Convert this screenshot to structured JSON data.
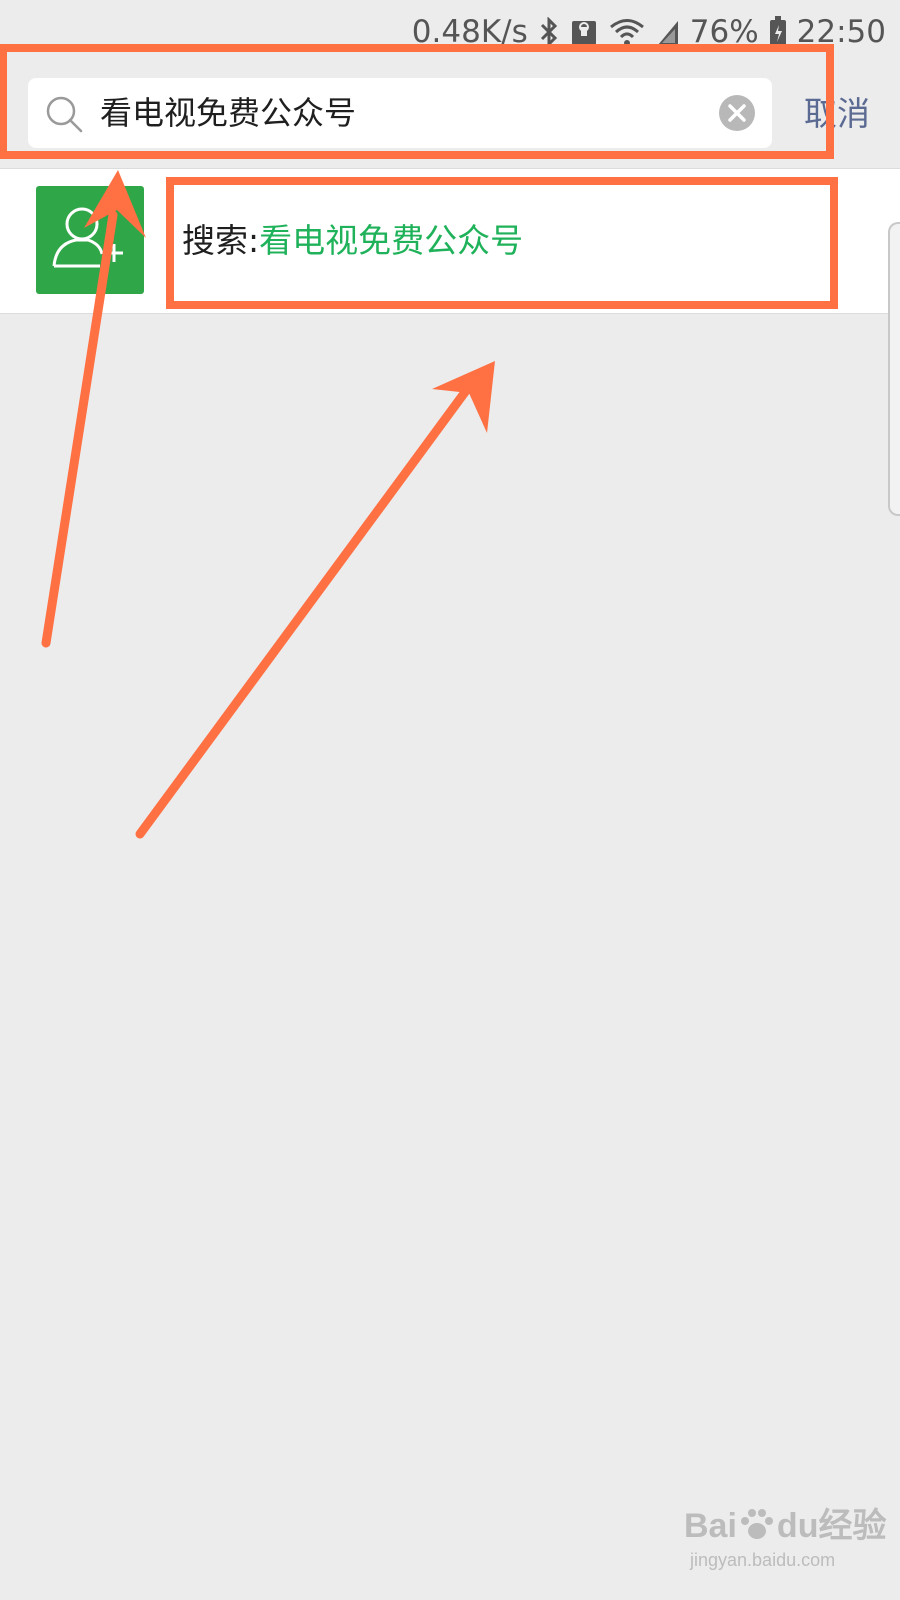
{
  "status_bar": {
    "speed": "0.48K/s",
    "battery": "76%",
    "time": "22:50",
    "icons": [
      "bluetooth-icon",
      "lock-icon",
      "wifi-icon",
      "signal-icon",
      "battery-icon"
    ]
  },
  "search": {
    "query": "看电视免费公众号",
    "cancel_label": "取消"
  },
  "result": {
    "prefix": "搜索:",
    "query": "看电视免费公众号",
    "icon": "add-contact-icon"
  },
  "watermark": {
    "brand_left": "Bai",
    "brand_right": "du",
    "product": "经验",
    "url": "jingyan.baidu.com"
  },
  "colors": {
    "background": "#ececec",
    "annotation": "#ff7043",
    "result_query": "#1fb25a",
    "cancel": "#5b6a92",
    "avatar": "#2fa748"
  }
}
